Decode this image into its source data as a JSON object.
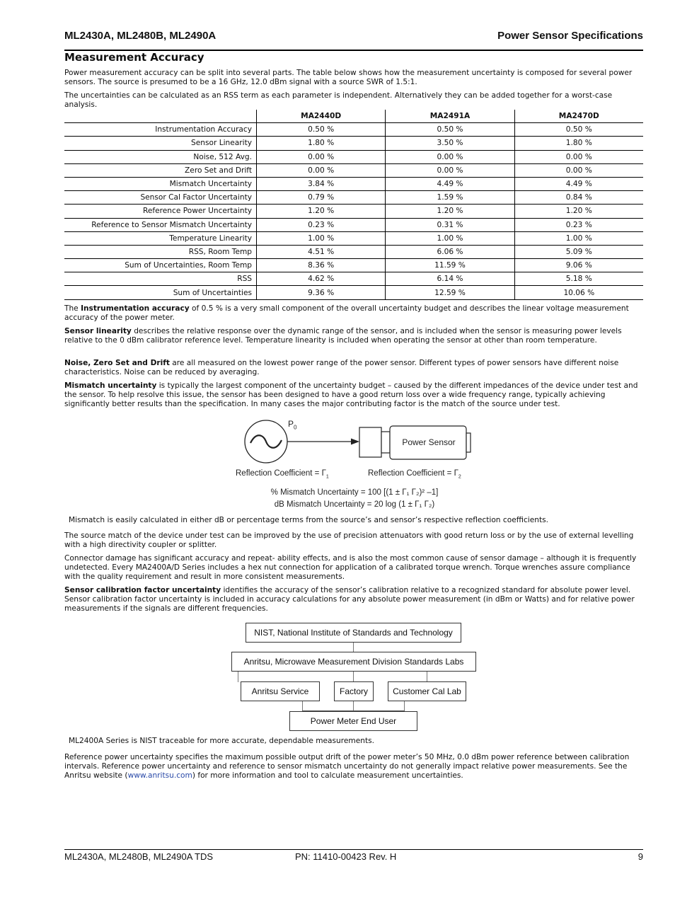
{
  "header": {
    "left": "ML2430A, ML2480B, ML2490A",
    "right": "Power Sensor Specifications"
  },
  "section_title": "Measurement Accuracy",
  "intro": [
    "Power measurement accuracy can be split into several parts. The table below shows how the measurement uncertainty is composed for several power sensors. The source is presumed to be a 16 GHz, 12.0 dBm signal with a source SWR of 1.5:1.",
    "The uncertainties can be calculated as an RSS term as each parameter is independent. Alternatively they can be added together for a worst-case analysis."
  ],
  "table": {
    "columns": [
      "MA2440D",
      "MA2491A",
      "MA2470D"
    ],
    "rows": [
      {
        "label": "Instrumentation Accuracy",
        "values": [
          "0.50 %",
          "0.50 %",
          "0.50 %"
        ]
      },
      {
        "label": "Sensor Linearity",
        "values": [
          "1.80 %",
          "3.50 %",
          "1.80 %"
        ]
      },
      {
        "label": "Noise, 512 Avg.",
        "values": [
          "0.00 %",
          "0.00 %",
          "0.00 %"
        ]
      },
      {
        "label": "Zero Set and Drift",
        "values": [
          "0.00 %",
          "0.00 %",
          "0.00 %"
        ]
      },
      {
        "label": "Mismatch Uncertainty",
        "values": [
          "3.84 %",
          "4.49 %",
          "4.49 %"
        ]
      },
      {
        "label": "Sensor Cal Factor Uncertainty",
        "values": [
          "0.79 %",
          "1.59 %",
          "0.84 %"
        ]
      },
      {
        "label": "Reference Power Uncertainty",
        "values": [
          "1.20 %",
          "1.20 %",
          "1.20 %"
        ]
      },
      {
        "label": "Reference to Sensor Mismatch Uncertainty",
        "values": [
          "0.23 %",
          "0.31 %",
          "0.23 %"
        ]
      },
      {
        "label": "Temperature Linearity",
        "values": [
          "1.00 %",
          "1.00 %",
          "1.00 %"
        ]
      },
      {
        "label": "RSS, Room Temp",
        "values": [
          "4.51 %",
          "6.06 %",
          "5.09 %"
        ]
      },
      {
        "label": "Sum of Uncertainties, Room Temp",
        "values": [
          "8.36 %",
          "11.59 %",
          "9.06 %"
        ]
      },
      {
        "label": "RSS",
        "values": [
          "4.62 %",
          "6.14 %",
          "5.18 %"
        ]
      },
      {
        "label": "Sum of Uncertainties",
        "values": [
          "9.36 %",
          "12.59 %",
          "10.06 %"
        ]
      }
    ]
  },
  "paragraphs": {
    "instr": {
      "bold": "Instrumentation accuracy",
      "pre": "The ",
      "rest": " of 0.5 % is a very small component of the overall uncertainty budget and describes the linear voltage measurement accuracy of the power meter."
    },
    "lin": {
      "bold": "Sensor linearity",
      "rest": " describes the relative response over the dynamic range of the sensor, and is included when the sensor is measuring power levels relative to the 0 dBm calibrator reference level. Temperature linearity is included when operating the sensor at other than room temperature."
    },
    "noise": {
      "bold": "Noise, Zero Set and Drift",
      "rest": " are all measured on the lowest power range of the power sensor. Different types of power sensors have different noise characteristics. Noise can be reduced by averaging."
    },
    "mism": {
      "bold": "Mismatch uncertainty",
      "rest": " is typically the largest component of the uncertainty budget – caused by the different impedances of the device under test and the sensor. To help resolve this issue, the sensor has been designed to have a good return loss over a wide frequency range, typically achieving significantly better results than the specification. In many cases the major contributing factor is the match of the source under test."
    },
    "mism_caption": "Mismatch is easily calculated in either dB or percentage terms from the source’s and sensor’s respective reflection coefficients.",
    "source": "The source match of the device under test can be improved by the use of precision attenuators with good return loss or by the use of external levelling with a high directivity coupler or splitter.",
    "connector": "Connector damage has significant accuracy and repeat- ability effects, and is also the most common cause of sensor damage – although it is frequently undetected. Every MA2400A/D Series includes a hex nut connection for application of a calibrated torque wrench. Torque wrenches assure compliance with the quality requirement and result in more consistent measurements.",
    "calfac": {
      "bold": "Sensor calibration factor uncertainty",
      "rest": " identifies the accuracy of the sensor’s calibration relative to a recognized standard for absolute power level. Sensor calibration factor uncertainty is included in accuracy calculations for any absolute power measurement (in dBm or Watts) and for relative power measurements if the signals are different frequencies."
    },
    "nist_caption": "ML2400A Series is NIST traceable for more accurate, dependable measurements.",
    "refpow": {
      "pre": "Reference power uncertainty specifies the maximum possible output drift of the power meter’s 50 MHz, 0.0 dBm power reference between calibration intervals. Reference power uncertainty and reference to sensor mismatch uncertainty do not generally impact relative power measurements. See the Anritsu website (",
      "link": "www.anritsu.com",
      "post": ") for more information and tool to calculate measurement uncertainties."
    }
  },
  "mismatch_diagram": {
    "p0": "P",
    "p0_sub": "0",
    "sensor_label": "Power Sensor",
    "refl1": "Reflection Coefficient = Γ",
    "refl1_sub": "1",
    "refl2": "Reflection Coefficient = Γ",
    "refl2_sub": "2",
    "formula1": "% Mismatch Uncertainty = 100 [(1 ± Γ₁ Γ₂)² –1]",
    "formula2": "dB Mismatch Uncertainty = 20 log (1 ± Γ₁ Γ₂)"
  },
  "traceability_diagram": {
    "nist": "NIST, National Institute of Standards and Technology",
    "anritsu": "Anritsu, Microwave Measurement Division Standards Labs",
    "service": "Anritsu Service",
    "factory": "Factory",
    "customer": "Customer Cal Lab",
    "enduser": "Power Meter End User"
  },
  "footer": {
    "left": "ML2430A, ML2480B, ML2490A TDS",
    "center": "PN: 11410-00423  Rev. H",
    "page": "9"
  }
}
